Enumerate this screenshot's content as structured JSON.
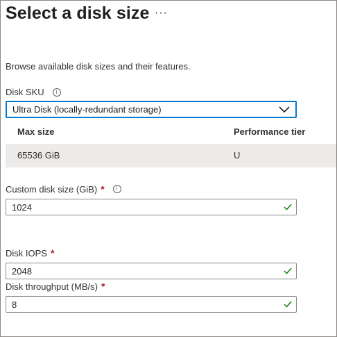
{
  "header": {
    "title": "Select a disk size",
    "more_label": "···"
  },
  "description": "Browse available disk sizes and their features.",
  "disk_sku": {
    "label": "Disk SKU",
    "selected_value": "Ultra Disk (locally-redundant storage)"
  },
  "table": {
    "columns": [
      "Max size",
      "Performance tier"
    ],
    "rows": [
      [
        "65536 GiB",
        "U"
      ]
    ]
  },
  "custom_size": {
    "label": "Custom disk size (GiB)",
    "required_mark": "*",
    "value": "1024"
  },
  "iops": {
    "label": "Disk IOPS",
    "required_mark": "*",
    "value": "2048"
  },
  "throughput": {
    "label": "Disk throughput (MB/s)",
    "required_mark": "*",
    "value": "8"
  },
  "colors": {
    "accent": "#0078d4",
    "valid_check": "#107c10",
    "required": "#a4262c",
    "row_background": "#edebe9"
  },
  "icons": {
    "info": "info-icon",
    "chevron": "chevron-down-icon",
    "valid": "checkmark-icon"
  }
}
